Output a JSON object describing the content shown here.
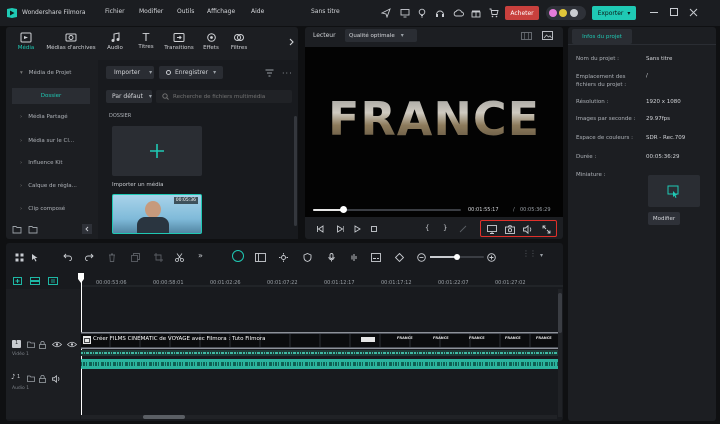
{
  "app": {
    "name": "Wondershare Filmora",
    "menu": [
      "Fichier",
      "Modifier",
      "Outils",
      "Affichage",
      "Aide"
    ],
    "project_title": "Sans titre",
    "buy_label": "Acheter",
    "export_label": "Exporter",
    "export_caret": "▾"
  },
  "media": {
    "tabs": [
      "Média",
      "Médias d'archives",
      "Audio",
      "Titres",
      "Transitions",
      "Effets",
      "Filtres"
    ],
    "sidebar": [
      {
        "label": "Média de Projet",
        "caret": "▾"
      },
      {
        "label": "Dossier",
        "caret": ""
      },
      {
        "label": "Média Partagé",
        "caret": "›"
      },
      {
        "label": "Média sur le Cl...",
        "caret": "›"
      },
      {
        "label": "Influence Kit",
        "caret": "›"
      },
      {
        "label": "Calque de régla...",
        "caret": "›"
      },
      {
        "label": "Clip composé",
        "caret": "›"
      }
    ],
    "import_label": "Importer",
    "record_label": "Enregistrer",
    "sort_label": "Par défaut",
    "search_placeholder": "Recherche de fichiers multimédia",
    "folder_label": "DOSSIER",
    "import_media_label": "Importer un média",
    "thumb_duration": "00:05:36"
  },
  "player": {
    "label": "Lecteur",
    "quality": "Qualité optimale",
    "preview_text": "FRANCE",
    "current_time": "00:01:55:17",
    "separator": "/",
    "total_time": "00:05:36:29",
    "progress": 0.2
  },
  "props": {
    "tab": "Infos du projet",
    "rows": [
      {
        "label": "Nom du projet :",
        "value": "Sans titre"
      },
      {
        "label": "Emplacement des fichiers du projet :",
        "value": "/"
      },
      {
        "label": "Résolution :",
        "value": "1920 x 1080"
      },
      {
        "label": "Images par seconde :",
        "value": "29.97fps"
      },
      {
        "label": "Espace de couleurs :",
        "value": "SDR - Rec.709"
      },
      {
        "label": "Durée :",
        "value": "00:05:36:29"
      },
      {
        "label": "Miniature :",
        "value": ""
      }
    ],
    "modify_label": "Modifier"
  },
  "timeline": {
    "ruler": [
      "00:00:53:06",
      "00:00:58:01",
      "00:01:02:26",
      "00:01:07:22",
      "00:01:12:17",
      "00:01:17:12",
      "00:01:22:07",
      "00:01:27:02"
    ],
    "clip_title": "Créer FILMS CINEMATIC de VOYAGE avec Filmora : Tuto Filmora",
    "track_labels": [
      "Vidéo 1",
      "Audio 1"
    ],
    "track_numbers": [
      "1",
      "1"
    ],
    "thumb_words": [
      "FRANCE",
      "FRANCE",
      "FRANCE",
      "FRANCE",
      "FRANCE"
    ]
  },
  "colors": {
    "accent": "#1fc9b4",
    "buy": "#c8403d",
    "highlight_box": "#e0302a"
  }
}
